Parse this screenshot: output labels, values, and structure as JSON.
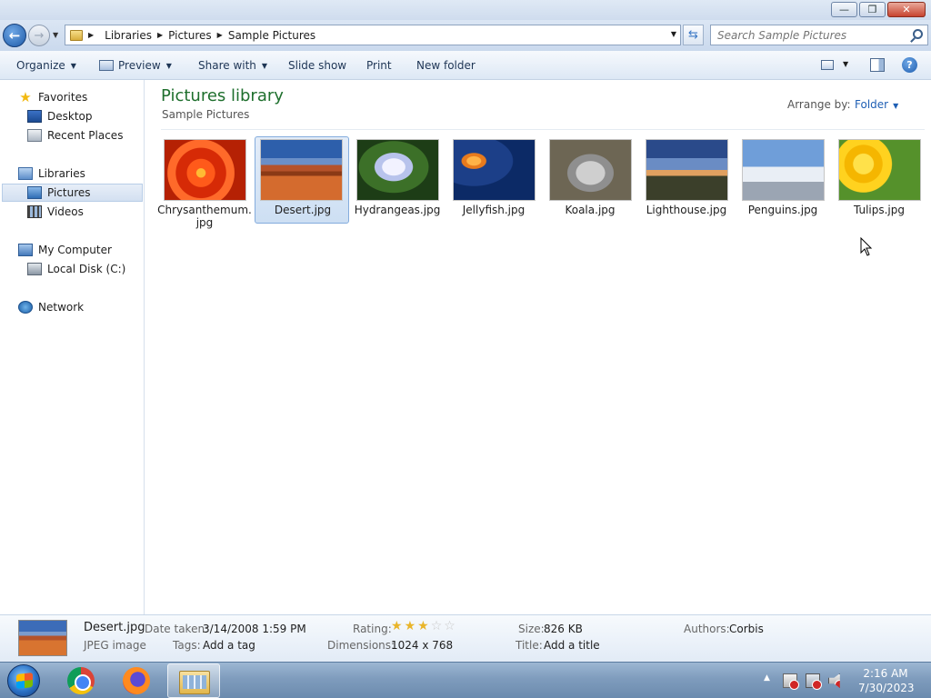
{
  "window": {
    "minimize_glyph": "—",
    "restore_glyph": "❐",
    "close_glyph": "✕"
  },
  "address": {
    "crumbs": [
      "Libraries",
      "Pictures",
      "Sample Pictures"
    ],
    "search_placeholder": "Search Sample Pictures"
  },
  "toolbar": {
    "organize": "Organize",
    "preview": "Preview",
    "share_with": "Share with",
    "slide_show": "Slide show",
    "print": "Print",
    "new_folder": "New folder"
  },
  "nav": {
    "favorites": "Favorites",
    "desktop": "Desktop",
    "recent_places": "Recent Places",
    "libraries": "Libraries",
    "pictures": "Pictures",
    "videos": "Videos",
    "my_computer": "My Computer",
    "local_disk": "Local Disk (C:)",
    "network": "Network"
  },
  "library": {
    "title": "Pictures library",
    "subtitle": "Sample Pictures",
    "arrange_label": "Arrange by:",
    "arrange_value": "Folder"
  },
  "files": [
    {
      "line1": "Chrysanthemum.",
      "line2": "jpg"
    },
    {
      "line1": "Desert.jpg",
      "line2": ""
    },
    {
      "line1": "Hydrangeas.jpg",
      "line2": ""
    },
    {
      "line1": "Jellyfish.jpg",
      "line2": ""
    },
    {
      "line1": "Koala.jpg",
      "line2": ""
    },
    {
      "line1": "Lighthouse.jpg",
      "line2": ""
    },
    {
      "line1": "Penguins.jpg",
      "line2": ""
    },
    {
      "line1": "Tulips.jpg",
      "line2": ""
    }
  ],
  "details": {
    "name": "Desert.jpg",
    "type": "JPEG image",
    "date_label": "Date taken:",
    "date_value": "3/14/2008 1:59 PM",
    "tags_label": "Tags:",
    "tags_value": "Add a tag",
    "rating_label": "Rating:",
    "rating": 3,
    "rating_max": 5,
    "dimensions_label": "Dimensions:",
    "dimensions_value": "1024 x 768",
    "size_label": "Size:",
    "size_value": "826 KB",
    "title_label": "Title:",
    "title_value": "Add a title",
    "authors_label": "Authors:",
    "authors_value": "Corbis"
  },
  "taskbar": {
    "time": "2:16 AM",
    "date": "7/30/2023"
  }
}
